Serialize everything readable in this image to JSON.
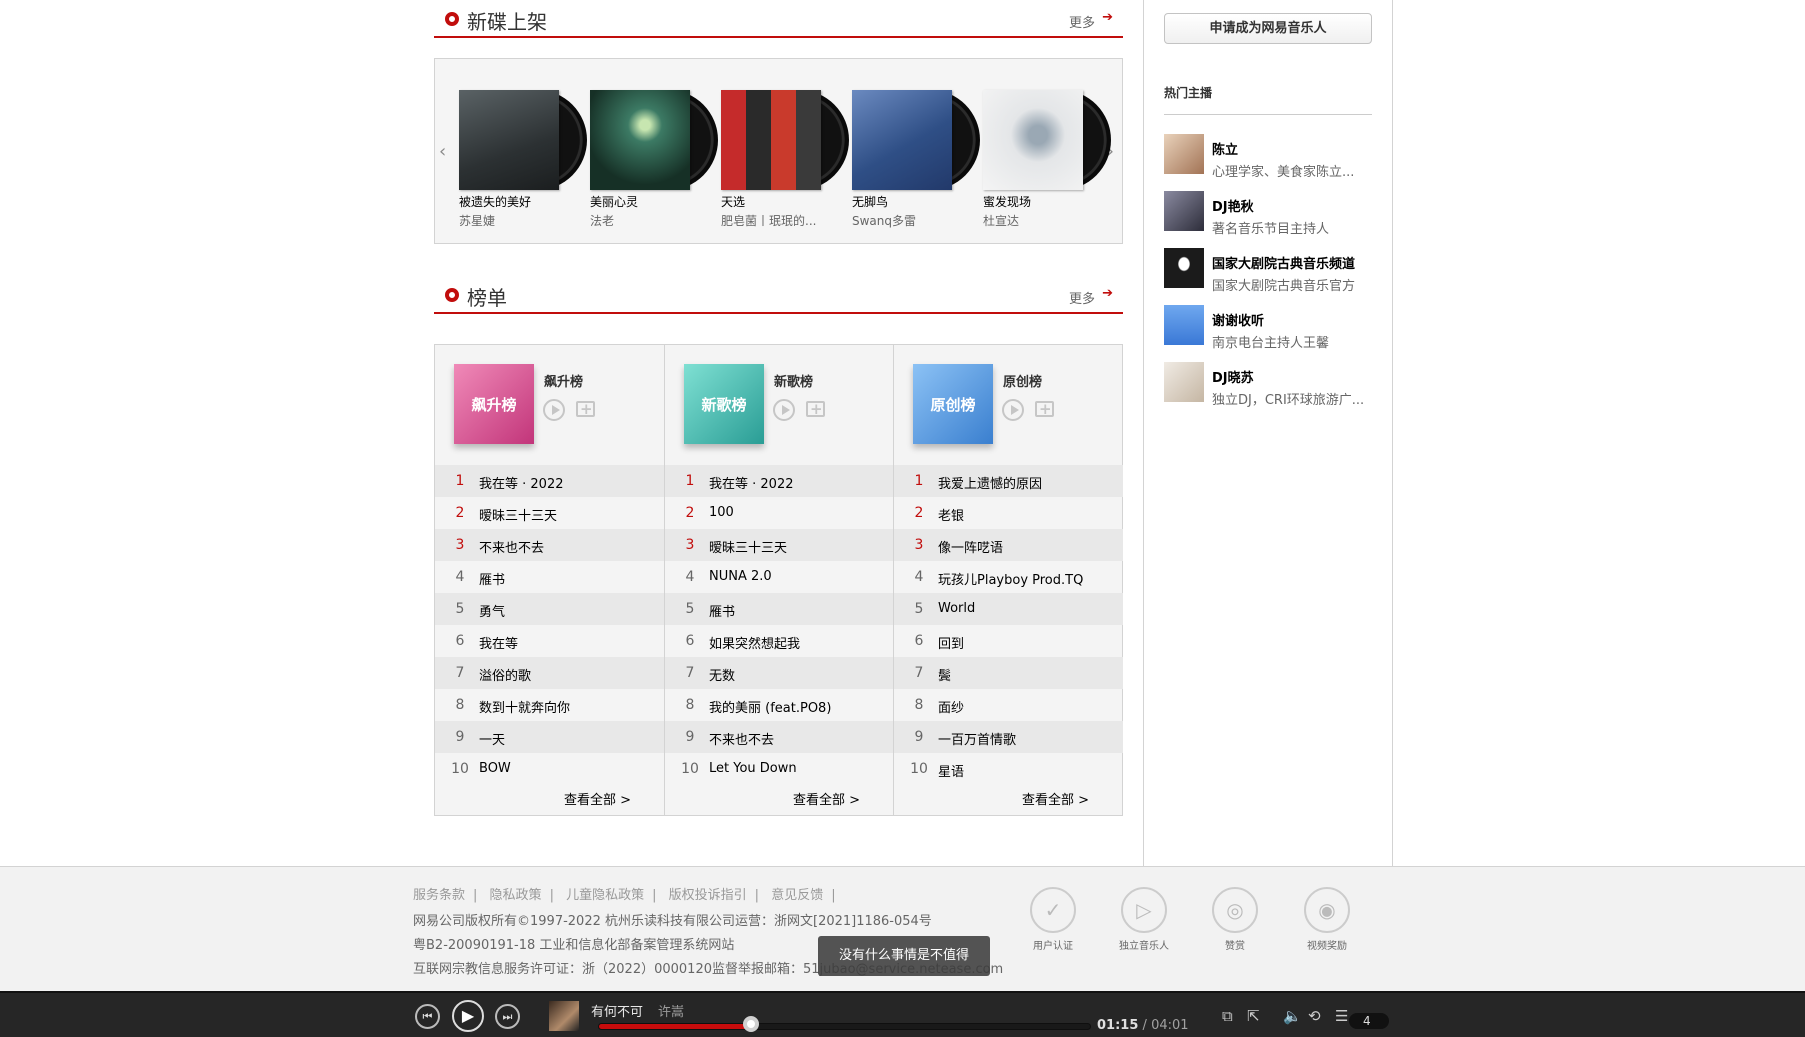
{
  "new_albums": {
    "title": "新碟上架",
    "more": "更多",
    "items": [
      {
        "name": "被遗失的美好",
        "artist": "苏星婕",
        "color": "#2e3335"
      },
      {
        "name": "美丽心灵",
        "artist": "法老",
        "color": "#1f3b33"
      },
      {
        "name": "天选",
        "artist": "肥皂菌丨珉珉的...",
        "color": "#b32a2a"
      },
      {
        "name": "无脚鸟",
        "artist": "Swanq多雷",
        "color": "#2f4f86"
      },
      {
        "name": "蜜发现场",
        "artist": "杜宣达",
        "color": "#e6e6e6"
      }
    ]
  },
  "charts": {
    "title": "榜单",
    "more": "更多",
    "view_all": "查看全部 >",
    "lists": [
      {
        "name": "飙升榜",
        "cover_label": "飙升榜",
        "color": "#d6418a",
        "songs": [
          "我在等 · 2022",
          "暧昧三十三天",
          "不来也不去",
          "雁书",
          "勇气",
          "我在等",
          "溢俗的歌",
          "数到十就奔向你",
          "一天",
          "BOW"
        ]
      },
      {
        "name": "新歌榜",
        "cover_label": "新歌榜",
        "color": "#3bb3ab",
        "songs": [
          "我在等 · 2022",
          "100",
          "暧昧三十三天",
          "NUNA 2.0",
          "雁书",
          "如果突然想起我",
          "无数",
          "我的美丽 (feat.PO8)",
          "不来也不去",
          "Let You Down"
        ]
      },
      {
        "name": "原创榜",
        "cover_label": "原创榜",
        "color": "#4a8fd6",
        "songs": [
          "我爱上遗憾的原因",
          "老银",
          "像一阵呓语",
          "玩孩儿Playboy Prod.TQ",
          "World",
          "回到",
          "鬓",
          "面纱",
          "一百万首情歌",
          "星语"
        ]
      }
    ]
  },
  "sidebar": {
    "apply_button": "申请成为网易音乐人",
    "hot_title": "热门主播",
    "djs": [
      {
        "name": "陈立",
        "desc": "心理学家、美食家陈立...",
        "color": "#b98a6a"
      },
      {
        "name": "DJ艳秋",
        "desc": "著名音乐节目主持人",
        "color": "#4a4a5a"
      },
      {
        "name": "国家大剧院古典音乐频道",
        "desc": "国家大剧院古典音乐官方",
        "color": "#1b1b1b"
      },
      {
        "name": "谢谢收听",
        "desc": "南京电台主持人王馨",
        "color": "#4f8fe0"
      },
      {
        "name": "DJ晓苏",
        "desc": "独立DJ，CRI环球旅游广...",
        "color": "#d8cfc4"
      }
    ]
  },
  "footer": {
    "links": [
      "服务条款",
      "隐私政策",
      "儿童隐私政策",
      "版权投诉指引",
      "意见反馈"
    ],
    "line1": "网易公司版权所有©1997-2022   杭州乐读科技有限公司运营：浙网文[2021]1186-054号",
    "line2": "粤B2-20090191-18  工业和信息化部备案管理系统网站",
    "line3": "互联网宗教信息服务许可证：浙（2022）0000120监督举报邮箱：51jubao@service.netease.com",
    "icons": [
      {
        "label": "用户认证",
        "icon": "shield-check-icon"
      },
      {
        "label": "独立音乐人",
        "icon": "music-play-icon"
      },
      {
        "label": "赞赏",
        "icon": "reward-icon"
      },
      {
        "label": "视频奖励",
        "icon": "video-reward-icon"
      }
    ],
    "toast": "没有什么事情是不值得"
  },
  "player": {
    "title": "有何不可",
    "artist": "许嵩",
    "current_time": "01:15",
    "separator": "/",
    "total_time": "04:01",
    "progress": 0.31,
    "playlist_count": "4"
  }
}
